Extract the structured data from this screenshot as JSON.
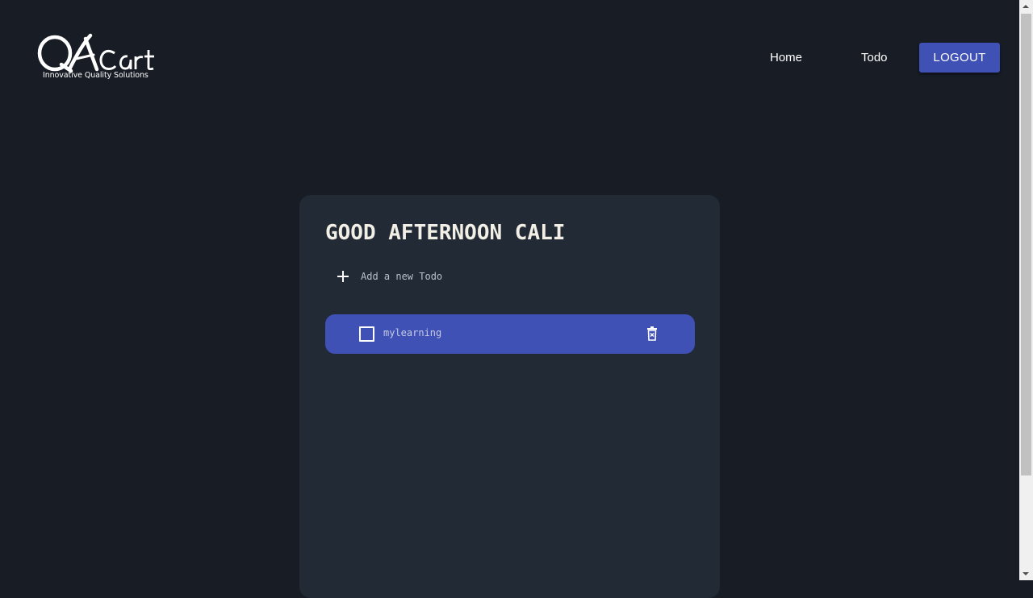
{
  "header": {
    "logo": {
      "brand_text": "QACart",
      "tagline": "Innovative Quality Solutions"
    },
    "nav": {
      "home_label": "Home",
      "todo_label": "Todo",
      "logout_label": "LOGOUT"
    }
  },
  "main": {
    "greeting": "GOOD AFTERNOON CALI",
    "add_todo": {
      "placeholder": "Add a new Todo",
      "value": ""
    },
    "todos": [
      {
        "text": "mylearning",
        "completed": false
      }
    ]
  },
  "colors": {
    "background": "#171c25",
    "card": "#222a35",
    "accent": "#3f51b5",
    "heading": "#f2efe6"
  }
}
